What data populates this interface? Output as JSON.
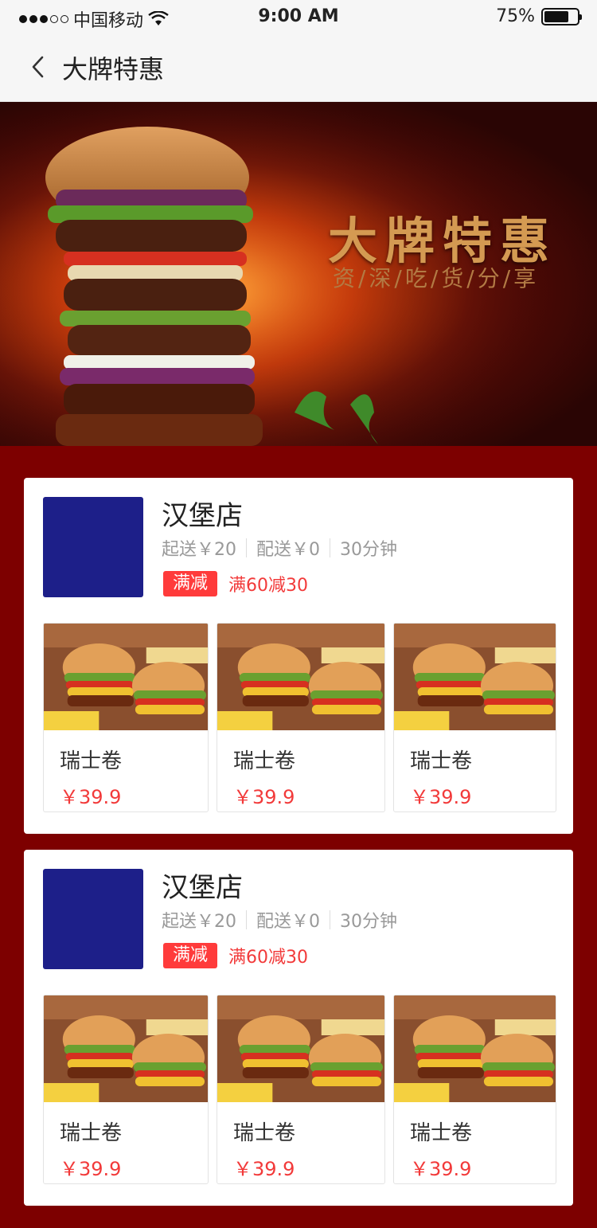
{
  "status_bar": {
    "carrier": "中国移动",
    "time": "9:00 AM",
    "battery_level": "75%",
    "battery_fraction": 0.75
  },
  "nav": {
    "title": "大牌特惠"
  },
  "banner": {
    "title": "大牌特惠",
    "subtitle": "资/深/吃/货/分/享"
  },
  "stores": [
    {
      "name": "汉堡店",
      "min_order": "起送￥20",
      "delivery_fee": "配送￥0",
      "delivery_time": "30分钟",
      "promo_badge": "满减",
      "promo_text": "满60减30",
      "products": [
        {
          "name": "瑞士卷",
          "price": "￥39.9"
        },
        {
          "name": "瑞士卷",
          "price": "￥39.9"
        },
        {
          "name": "瑞士卷",
          "price": "￥39.9"
        }
      ]
    },
    {
      "name": "汉堡店",
      "min_order": "起送￥20",
      "delivery_fee": "配送￥0",
      "delivery_time": "30分钟",
      "promo_badge": "满减",
      "promo_text": "满60减30",
      "products": [
        {
          "name": "瑞士卷",
          "price": "￥39.9"
        },
        {
          "name": "瑞士卷",
          "price": "￥39.9"
        },
        {
          "name": "瑞士卷",
          "price": "￥39.9"
        }
      ]
    }
  ],
  "colors": {
    "page_background": "#7d0000",
    "store_logo": "#1d1f89",
    "promo_red": "#f23a3a",
    "banner_gold": "#d49a52"
  }
}
